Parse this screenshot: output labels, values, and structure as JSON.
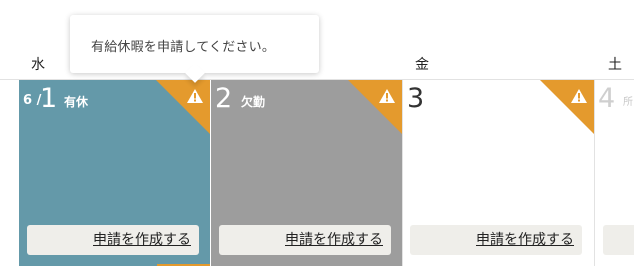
{
  "tooltip": {
    "text": "有給休暇を申請してください。"
  },
  "weekdays": {
    "wed": "水",
    "fri": "金",
    "sat": "土"
  },
  "days": [
    {
      "month": "6 /",
      "date": "1",
      "status": "有休",
      "warning_icon": "warning-triangle-icon",
      "button": "申請を作成する",
      "color": "#6499a9"
    },
    {
      "date": "2",
      "status": "欠勤",
      "warning_icon": "warning-triangle-icon",
      "button": "申請を作成する",
      "color": "#9d9d9d"
    },
    {
      "date": "3",
      "status": "",
      "warning_icon": "warning-triangle-icon",
      "button": "申請を作成する",
      "color": "#ffffff"
    },
    {
      "date": "4",
      "status": "所",
      "button": "",
      "color": "#ffffff"
    }
  ],
  "colors": {
    "warning": "#e49a2d",
    "button_bg": "#efeeea"
  }
}
